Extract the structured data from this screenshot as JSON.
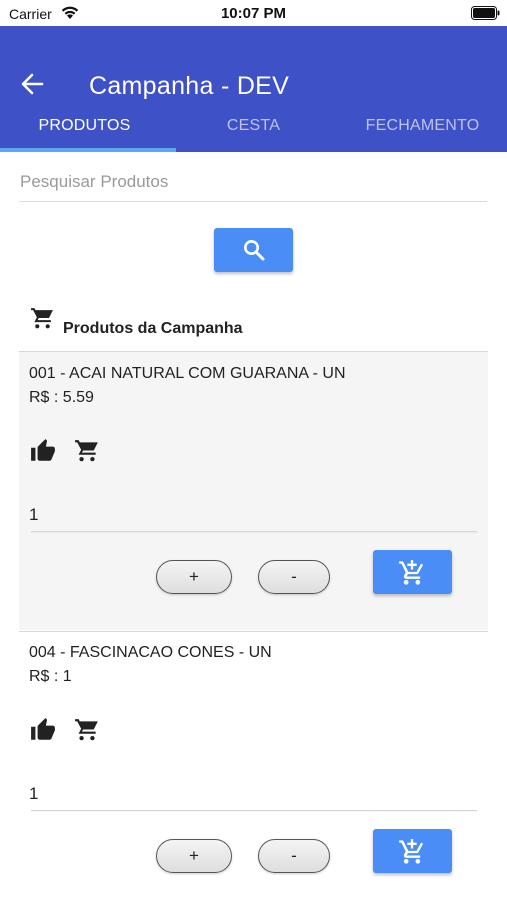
{
  "status_bar": {
    "carrier": "Carrier",
    "time": "10:07 PM"
  },
  "header": {
    "title": "Campanha - DEV",
    "back_icon": "arrow-left-icon"
  },
  "tabs": [
    {
      "label": "PRODUTOS",
      "active": true
    },
    {
      "label": "CESTA",
      "active": false
    },
    {
      "label": "FECHAMENTO",
      "active": false
    }
  ],
  "search": {
    "placeholder": "Pesquisar Produtos",
    "value": "",
    "button_icon": "search-icon"
  },
  "section": {
    "title": "Produtos da Campanha",
    "icon": "cart-icon"
  },
  "products": [
    {
      "name": "001 - ACAI NATURAL COM GUARANA - UN",
      "price": "R$ : 5.59",
      "quantity": "1",
      "plus_label": "+",
      "minus_label": "-"
    },
    {
      "name": "004 - FASCINACAO CONES - UN",
      "price": "R$ : 1",
      "quantity": "1",
      "plus_label": "+",
      "minus_label": "-"
    }
  ],
  "colors": {
    "header_bg": "#3f51c7",
    "tab_indicator": "#5aa9f5",
    "button_blue": "#4a8df6"
  }
}
